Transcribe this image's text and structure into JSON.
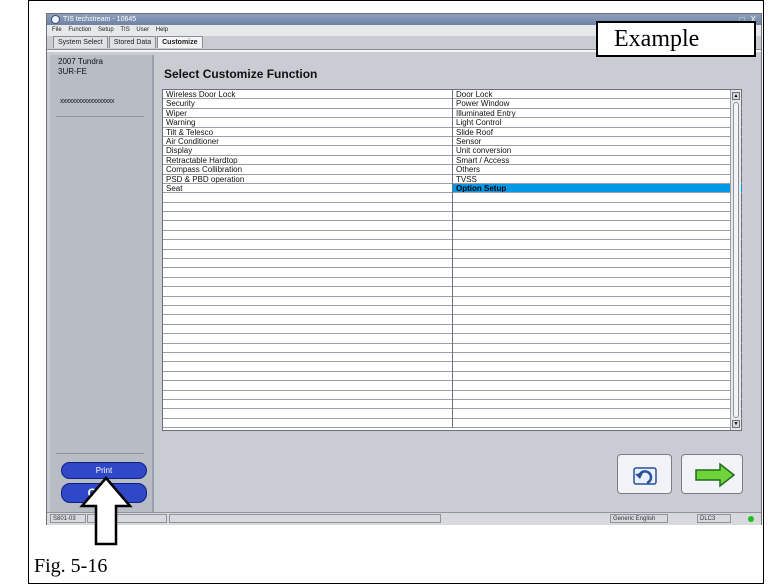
{
  "window": {
    "title": "TIS techstream - 10645",
    "window_controls": "_ □ X",
    "menu": [
      "File",
      "Function",
      "Setup",
      "TIS",
      "User",
      "Help"
    ],
    "tabs": [
      "System Select",
      "Stored Data",
      "Customize"
    ]
  },
  "left_panel": {
    "vehicle_year_model": "2007 Tundra",
    "engine": "3UR-FE",
    "vin_masked": "xxxxxxxxxxxxxxxxxx",
    "print_label": "Print",
    "close_label": "Close"
  },
  "main": {
    "heading": "Select Customize Function",
    "left_items": [
      "Wireless Door Lock",
      "Security",
      "Wiper",
      "Warning",
      "Tilt & Telesco",
      "Air Conditioner",
      "Display",
      "Retractable Hardtop",
      "Compass Collibration",
      "PSD & PBD operation",
      "Seat"
    ],
    "right_items": [
      "Door Lock",
      "Power Window",
      "Illuminated Entry",
      "Light Control",
      "Slide Roof",
      "Sensor",
      "Unit conversion",
      "Smart / Access",
      "Others",
      "TVSS",
      "Option Setup"
    ],
    "selected_item": "Option Setup",
    "selection_color": "#0099e8"
  },
  "statusbar": {
    "code": "S801-03",
    "language": "Generic English",
    "connection": "DLC3",
    "connection_status_color": "#1fbf22"
  },
  "annotations": {
    "example_label": "Example",
    "figure_caption": "Fig. 5-16"
  },
  "icons": {
    "back_button": "undo-arrow-icon",
    "next_button": "next-arrow-icon",
    "pointer": "up-arrow-callout-icon"
  }
}
